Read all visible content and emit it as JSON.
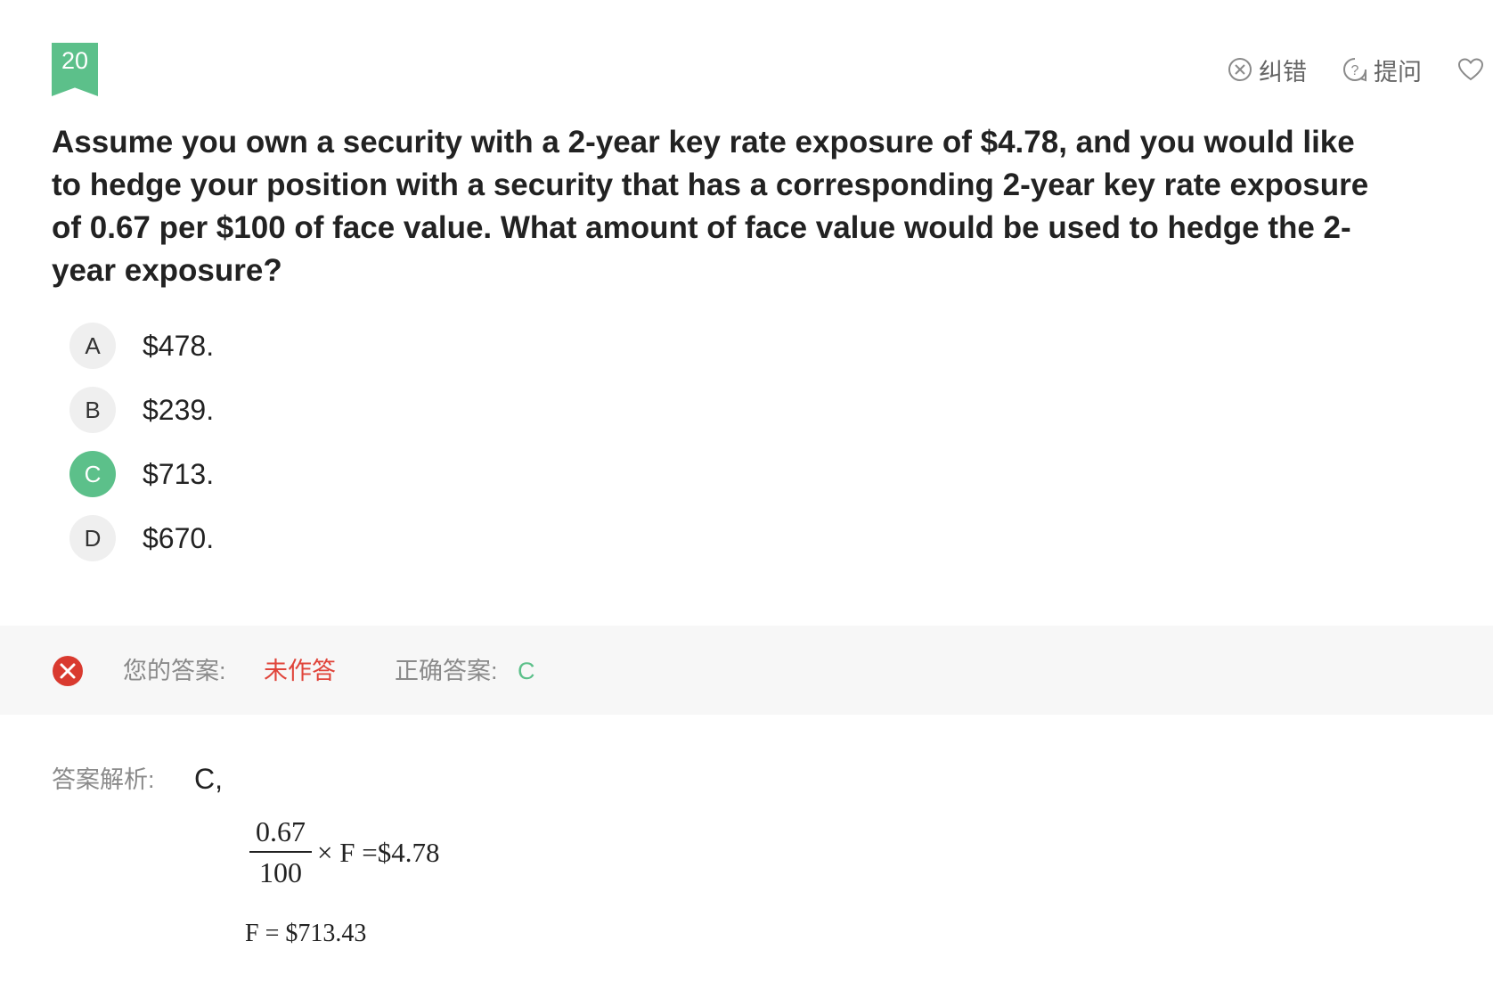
{
  "question": {
    "number": "20",
    "stem": "Assume you own a security with a 2-year key rate exposure of $4.78, and you would like to hedge your position with a security that has a corresponding 2-year key rate exposure of 0.67 per $100 of face value. What amount of face value would be used to hedge the 2-year exposure?"
  },
  "toolbar": {
    "report_error_label": "纠错",
    "ask_label": "提问",
    "report_error_icon": "circle-x-icon",
    "ask_icon": "circle-question-icon",
    "favorite_icon": "heart-icon"
  },
  "options": [
    {
      "letter": "A",
      "text": "$478.",
      "correct": false
    },
    {
      "letter": "B",
      "text": "$239.",
      "correct": false
    },
    {
      "letter": "C",
      "text": "$713.",
      "correct": true
    },
    {
      "letter": "D",
      "text": "$670.",
      "correct": false
    }
  ],
  "answer": {
    "status_icon": "wrong-circle-icon",
    "your_answer_label": "您的答案:",
    "your_answer_value": "未作答",
    "correct_answer_label": "正确答案:",
    "correct_answer_value": "C"
  },
  "analysis": {
    "label": "答案解析:",
    "answer_text": "C,",
    "formula_numerator": "0.67",
    "formula_denominator": "100",
    "formula_rest": "× F =$4.78",
    "result": "F = $713.43"
  },
  "colors": {
    "accent_green": "#5cc08a",
    "wrong_red": "#d93a2f",
    "unanswered_red": "#e0443a",
    "answer_bar_bg": "#f7f7f7"
  }
}
